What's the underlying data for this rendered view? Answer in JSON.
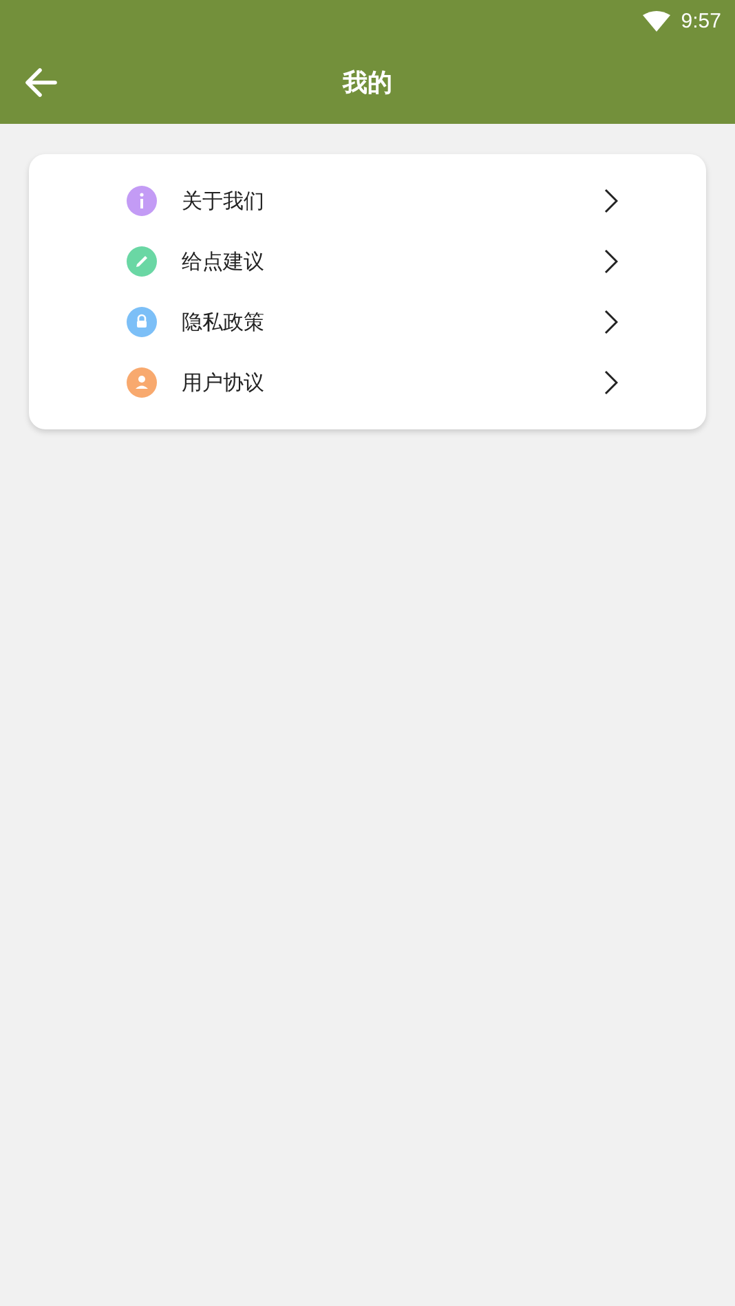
{
  "status_bar": {
    "time": "9:57"
  },
  "toolbar": {
    "title": "我的"
  },
  "menu": [
    {
      "label": "关于我们",
      "kind": "info",
      "color": "#c39bf5"
    },
    {
      "label": "给点建议",
      "kind": "pencil",
      "color": "#6ad7a4"
    },
    {
      "label": "隐私政策",
      "kind": "lock",
      "color": "#7cbff7"
    },
    {
      "label": "用户协议",
      "kind": "person",
      "color": "#f8a96e"
    }
  ]
}
